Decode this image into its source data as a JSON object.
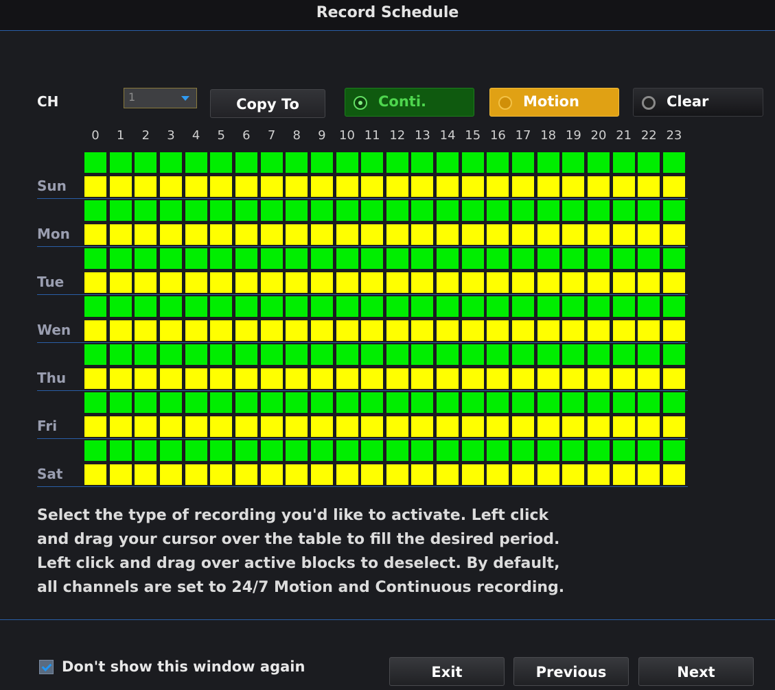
{
  "window": {
    "title": "Record Schedule"
  },
  "controls": {
    "channel_label": "CH",
    "channel_value": "1",
    "copy_to_label": "Copy To",
    "modes": {
      "conti_label": "Conti.",
      "motion_label": "Motion",
      "clear_label": "Clear",
      "selected": "Motion"
    }
  },
  "schedule": {
    "hours": [
      "0",
      "1",
      "2",
      "3",
      "4",
      "5",
      "6",
      "7",
      "8",
      "9",
      "10",
      "11",
      "12",
      "13",
      "14",
      "15",
      "16",
      "17",
      "18",
      "19",
      "20",
      "21",
      "22",
      "23"
    ],
    "days": [
      "Sun",
      "Mon",
      "Tue",
      "Wen",
      "Thu",
      "Fri",
      "Sat"
    ],
    "row_types": [
      "conti",
      "motion"
    ],
    "colors": {
      "conti": "#00ee00",
      "motion": "#ffff00"
    }
  },
  "instructions": {
    "lines": [
      "Select the type of recording you'd like to activate. Left click",
      "and drag your cursor over the table to fill the desired period.",
      "Left click and drag over active blocks to deselect. By default,",
      "all channels are set to 24/7 Motion and Continuous recording."
    ]
  },
  "footer": {
    "dont_show_label": "Don't show this window again",
    "dont_show_checked": true,
    "exit_label": "Exit",
    "previous_label": "Previous",
    "next_label": "Next"
  }
}
